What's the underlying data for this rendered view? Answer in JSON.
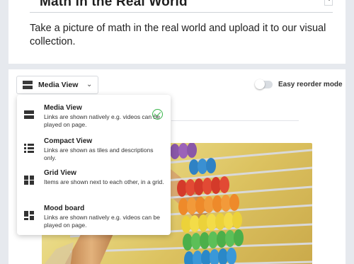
{
  "post": {
    "title": "Math in the Real World",
    "description": "Take a picture of math in the real world and upload it to our visual collection."
  },
  "toolbar": {
    "view_label": "Media View",
    "reorder_label": "Easy reorder mode",
    "reorder_enabled": false
  },
  "view_menu": {
    "selected": "Media View",
    "options": [
      {
        "title": "Media View",
        "desc": "Links are shown natively e.g. videos can be played on page.",
        "icon": "media-view-icon"
      },
      {
        "title": "Compact View",
        "desc": "Links are shown as tiles and descriptions only.",
        "icon": "compact-view-icon"
      },
      {
        "title": "Grid View",
        "desc": "Items are shown next to each other, in a grid.",
        "icon": "grid-view-icon"
      },
      {
        "title": "Mood board",
        "desc": "Links are shown natively e.g. videos can be played on page.",
        "icon": "mood-board-icon"
      }
    ]
  },
  "colors": {
    "accent_check": "#39b54a",
    "page_bg": "#e6e9ee"
  }
}
